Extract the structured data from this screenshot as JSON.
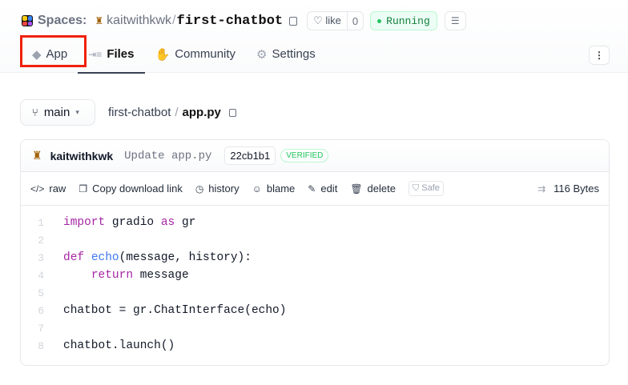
{
  "header": {
    "spaces_label": "Spaces:",
    "owner": "kaitwithkwk",
    "separator": "/",
    "repo": "first-chatbot",
    "like_label": "like",
    "like_count": "0",
    "status": "Running"
  },
  "tabs": [
    {
      "label": "App",
      "icon": "cube-icon"
    },
    {
      "label": "Files",
      "icon": "files-icon"
    },
    {
      "label": "Community",
      "icon": "clap-icon"
    },
    {
      "label": "Settings",
      "icon": "gear-icon"
    }
  ],
  "branch": {
    "label": "main"
  },
  "breadcrumb": {
    "repo": "first-chatbot",
    "separator": "/",
    "file": "app.py"
  },
  "commit": {
    "author": "kaitwithkwk",
    "message": "Update app.py",
    "hash": "22cb1b1",
    "badge": "VERIFIED"
  },
  "actions": {
    "raw": "raw",
    "copy": "Copy download link",
    "history": "history",
    "blame": "blame",
    "edit": "edit",
    "delete": "delete",
    "safe": "Safe",
    "size": "116 Bytes"
  },
  "code": [
    [
      {
        "t": "import",
        "c": "kw"
      },
      {
        "t": " gradio "
      },
      {
        "t": "as",
        "c": "kw"
      },
      {
        "t": " gr"
      }
    ],
    [],
    [
      {
        "t": "def",
        "c": "kw"
      },
      {
        "t": " "
      },
      {
        "t": "echo",
        "c": "fn"
      },
      {
        "t": "(message, history):"
      }
    ],
    [
      {
        "t": "    "
      },
      {
        "t": "return",
        "c": "kw"
      },
      {
        "t": " message"
      }
    ],
    [],
    [
      {
        "t": "chatbot = gr.ChatInterface(echo)"
      }
    ],
    [],
    [
      {
        "t": "chatbot.launch()"
      }
    ]
  ]
}
